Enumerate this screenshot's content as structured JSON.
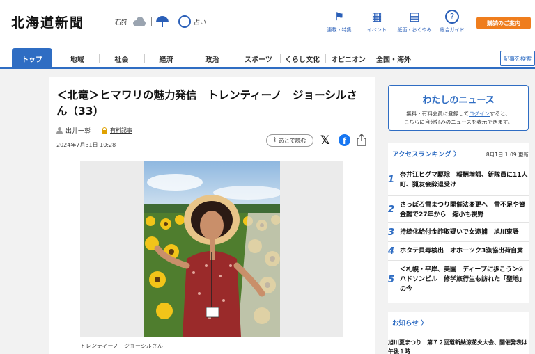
{
  "header": {
    "logo": "北海道新聞",
    "region": "石狩",
    "fortune": "占い",
    "icons": [
      {
        "icon": "flag-icon",
        "label": "連載・特集"
      },
      {
        "icon": "calendar-icon",
        "label": "イベント"
      },
      {
        "icon": "newspaper-icon",
        "label": "紙面・おくやみ"
      },
      {
        "icon": "question-icon",
        "label": "総合ガイド"
      }
    ],
    "subscribe": "購読のご案内"
  },
  "tabs": {
    "items": [
      "トップ",
      "地域",
      "社会",
      "経済",
      "政治",
      "スポーツ",
      "くらし文化",
      "オピニオン",
      "全国・海外"
    ],
    "search": "記事を検索"
  },
  "article": {
    "title": "＜北竜＞ヒマワリの魅力発信　トレンティーノ　ジョーシルさん（33）",
    "author": "出井一彰",
    "paid": "有料記事",
    "date": "2024年7月31日 10:28",
    "read_later": "あとで読む",
    "caption": "トレンティーノ　ジョーシルさん"
  },
  "my_news": {
    "title": "わたしのニュース",
    "line1_pre": "無料・有料会員に登録して",
    "line1_link": "ログイン",
    "line1_post": "すると、",
    "line2": "こちらに自分好みのニュースを表示できます。"
  },
  "ranking": {
    "title": "アクセスランキング  〉",
    "updated": "8月1日 1:09 更新",
    "items": [
      {
        "num": "1",
        "text": "奈井江ヒグマ駆除　報酬増額、新隊員に11人　町、猟友会辞退受け"
      },
      {
        "num": "2",
        "text": "さっぽろ雪まつり開催法変更へ　雪不足や資金難で27年から　縮小も視野"
      },
      {
        "num": "3",
        "text": "持続化給付金詐取疑いで女逮捕　旭川東署"
      },
      {
        "num": "4",
        "text": "ホタテ貝毒検出　オホーツク3漁協出荷自粛"
      },
      {
        "num": "5",
        "text": "＜札幌・平岸、美園　ディープに歩こう＞⑦　ハドソンビル　修学旅行生も訪れた「聖地」の今"
      }
    ]
  },
  "notice": {
    "title": "お知らせ  〉",
    "text": "旭川夏まつり　第７２回道新納涼花火大会、開催発表は午後１時"
  }
}
